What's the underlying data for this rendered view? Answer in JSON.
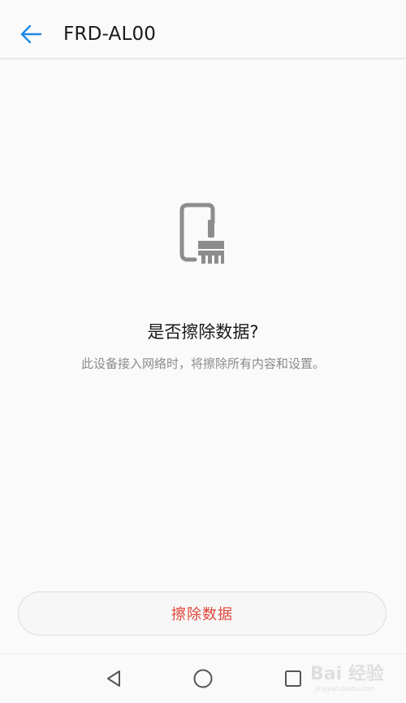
{
  "header": {
    "title": "FRD-AL00",
    "back_icon": "arrow-left-icon"
  },
  "main": {
    "icon": "phone-broom-icon",
    "question": "是否擦除数据?",
    "description": "此设备接入网络时，将擦除所有内容和设置。"
  },
  "action": {
    "erase_label": "擦除数据"
  },
  "navbar": {
    "back_icon": "nav-back-triangle-icon",
    "home_icon": "nav-home-circle-icon",
    "recent_icon": "nav-recent-square-icon"
  },
  "watermark": {
    "logo_text": "Bai 经验",
    "sub_text": "jingyan.baidu.com"
  },
  "colors": {
    "accent": "#1e88e5",
    "danger": "#e0463a",
    "icon_gray": "#8c8c8c",
    "background": "#fafafa"
  }
}
